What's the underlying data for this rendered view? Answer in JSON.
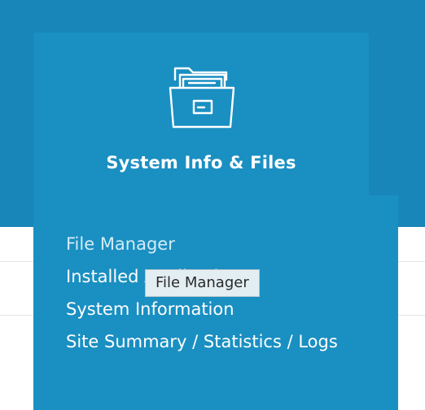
{
  "card": {
    "icon": "folder-icon",
    "title": "System Info & Files",
    "links": [
      {
        "label": "File Manager"
      },
      {
        "label": "Installed Applications"
      },
      {
        "label": "System Information"
      },
      {
        "label": "Site Summary / Statistics / Logs"
      }
    ]
  },
  "tooltip": {
    "text": "File Manager"
  },
  "colors": {
    "header_bg": "#1886b8",
    "card_bg": "#1a8fc2",
    "link_text": "#ffffff",
    "hovered_link_text": "#d3ecf7",
    "tooltip_bg": "#e3eef2"
  }
}
